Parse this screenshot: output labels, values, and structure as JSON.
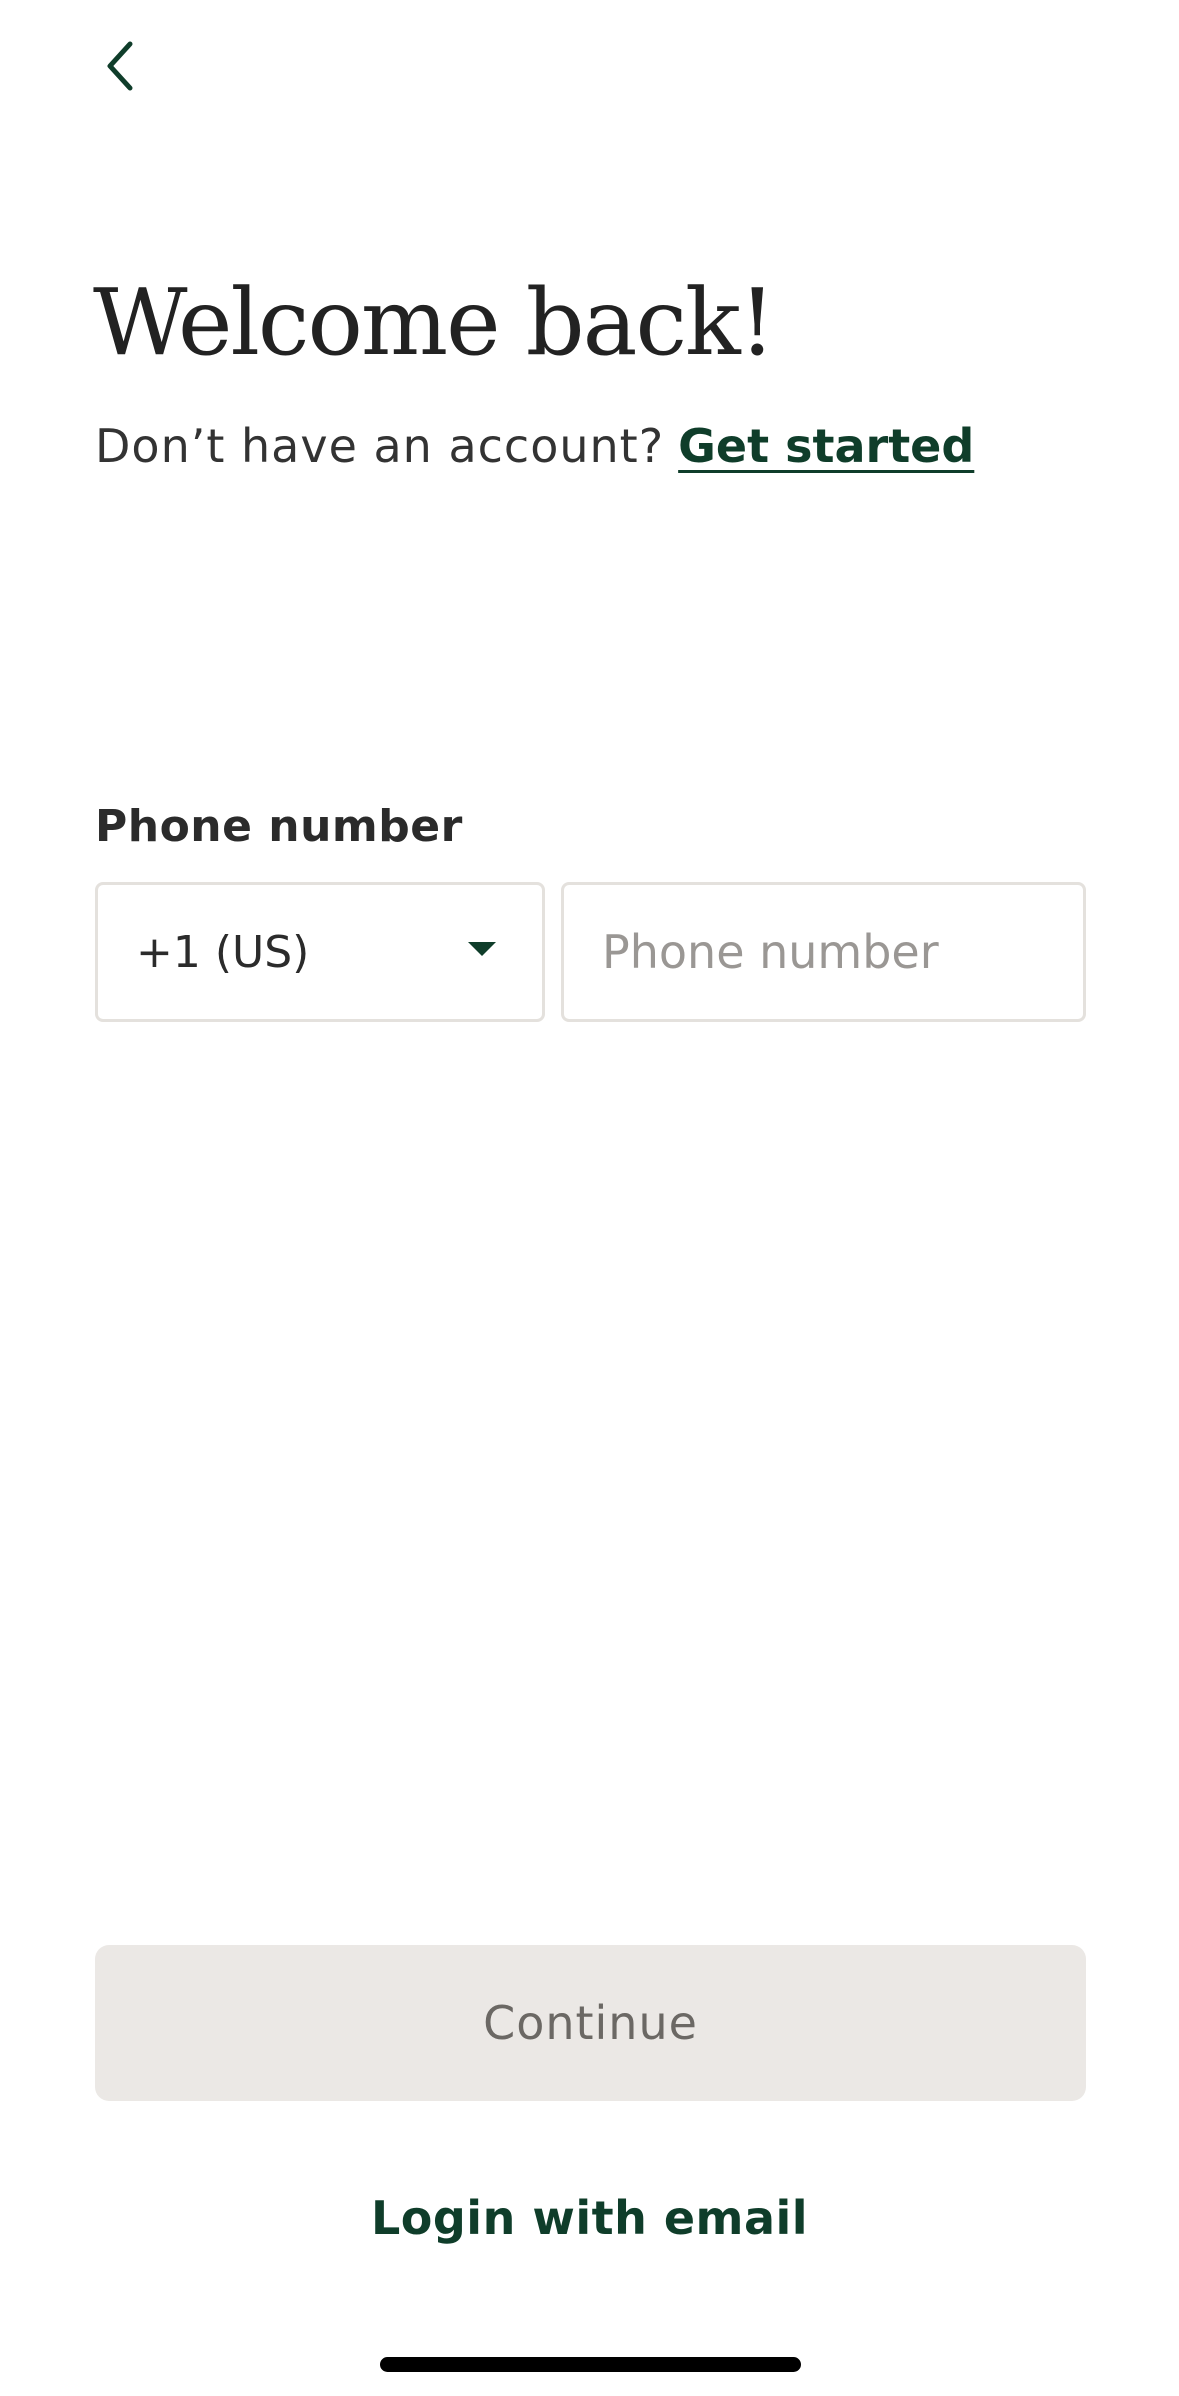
{
  "header": {
    "back_icon": "chevron-left-icon",
    "title": "Welcome back!"
  },
  "signup": {
    "prompt": "Don’t have an account?",
    "link": "Get started"
  },
  "phone": {
    "label": "Phone number",
    "country_code": "+1 (US)",
    "country_dropdown_icon": "caret-down-icon",
    "placeholder": "Phone number",
    "value": ""
  },
  "actions": {
    "continue_label": "Continue",
    "email_login_label": "Login with email"
  },
  "colors": {
    "accent": "#0f3d2a",
    "button_disabled_bg": "#ebe8e5",
    "button_disabled_text": "#6b6864",
    "border": "#e4e1dd"
  }
}
